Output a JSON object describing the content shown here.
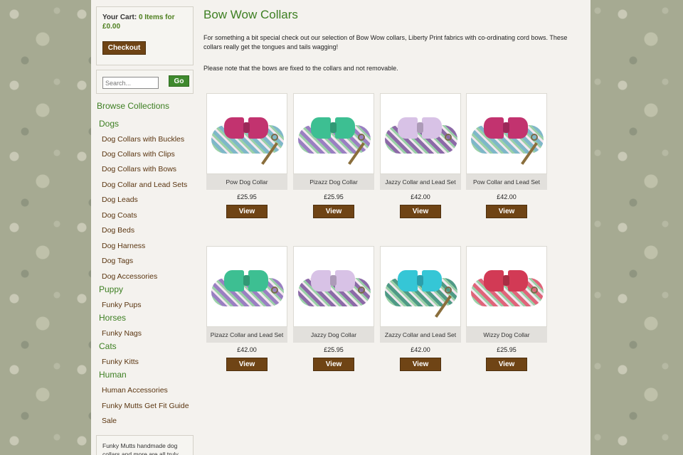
{
  "cart": {
    "label": "Your Cart:",
    "summary": "0 Items for £0.00",
    "checkout": "Checkout"
  },
  "search": {
    "placeholder": "Search...",
    "go": "Go"
  },
  "nav": {
    "title": "Browse Collections",
    "sections": [
      {
        "name": "Dogs",
        "items": [
          "Dog Collars with Buckles",
          "Dog Collars with Clips",
          "Dog Collars with Bows",
          "Dog Collar and Lead Sets",
          "Dog Leads",
          "Dog Coats",
          "Dog Beds",
          "Dog Harness",
          "Dog Tags",
          "Dog Accessories"
        ]
      },
      {
        "name": "Puppy",
        "items": [
          "Funky Pups"
        ]
      },
      {
        "name": "Horses",
        "items": [
          "Funky Nags"
        ]
      },
      {
        "name": "Cats",
        "items": [
          "Funky Kitts"
        ]
      },
      {
        "name": "Human",
        "items": [
          "Human Accessories",
          "Funky Mutts Get Fit Guide",
          "Sale"
        ]
      }
    ]
  },
  "about": {
    "text": "Funky Mutts handmade dog collars and more are all truly"
  },
  "main": {
    "title": "Bow Wow Collars",
    "intro": "For something a bit special check out our selection of Bow Wow collars, Liberty Print fabrics with co-ordinating cord bows.  These collars really get the tongues and tails wagging!",
    "note": "Please note that the bows are fixed to the collars and not removable.",
    "view_label": "View",
    "products": [
      {
        "name": "Pow Dog Collar",
        "price": "£25.95",
        "bow": "#c2336f",
        "fabric": "#7fb7c9",
        "lead": true
      },
      {
        "name": "Pizazz Dog Collar",
        "price": "£25.95",
        "bow": "#3dbf92",
        "fabric": "#9a7fc2",
        "lead": true
      },
      {
        "name": "Jazzy Collar and Lead Set",
        "price": "£42.00",
        "bow": "#d8c2e6",
        "fabric": "#8c6aa8",
        "lead": false
      },
      {
        "name": "Pow Collar and Lead Set",
        "price": "£42.00",
        "bow": "#c2336f",
        "fabric": "#7fb7c9",
        "lead": true
      },
      {
        "name": "Pizazz Collar and Lead Set",
        "price": "£42.00",
        "bow": "#3dbf92",
        "fabric": "#9a7fc2",
        "lead": false
      },
      {
        "name": "Jazzy Dog Collar",
        "price": "£25.95",
        "bow": "#d8c2e6",
        "fabric": "#8c6aa8",
        "lead": false
      },
      {
        "name": "Zazzy Collar and Lead Set",
        "price": "£42.00",
        "bow": "#35c6d6",
        "fabric": "#4f9a86",
        "lead": true
      },
      {
        "name": "Wizzy Dog Collar",
        "price": "£25.95",
        "bow": "#d23a55",
        "fabric": "#e0647a",
        "lead": false
      }
    ]
  }
}
